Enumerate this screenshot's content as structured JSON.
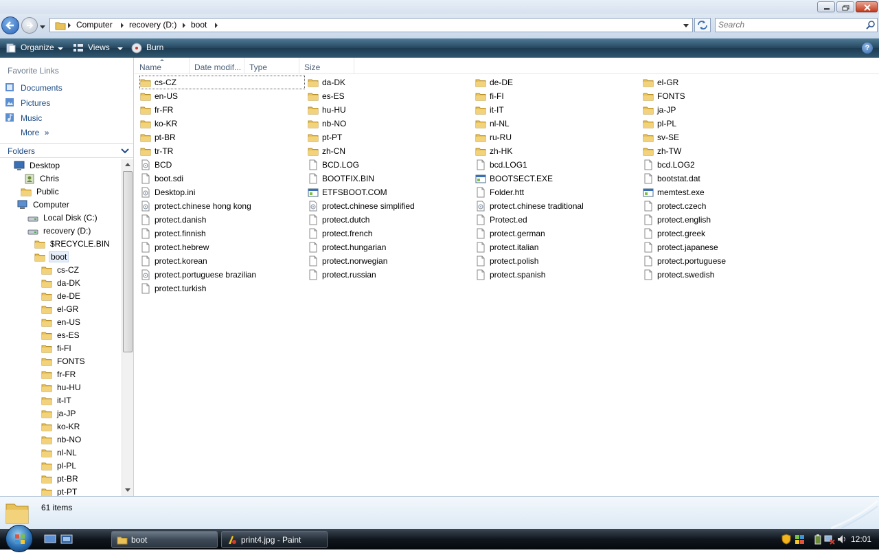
{
  "window": {
    "breadcrumb": [
      "Computer",
      "recovery (D:)",
      "boot"
    ],
    "search_placeholder": "Search"
  },
  "toolbar": {
    "organize": "Organize",
    "views": "Views",
    "burn": "Burn"
  },
  "nav": {
    "favorites_header": "Favorite Links",
    "favorites": [
      "Documents",
      "Pictures",
      "Music"
    ],
    "more": "More",
    "folders_header": "Folders",
    "tree": [
      {
        "label": "Desktop",
        "icon": "desktop-icon"
      },
      {
        "label": "Chris",
        "icon": "user-folder-icon"
      },
      {
        "label": "Public",
        "icon": "folder-icon"
      },
      {
        "label": "Computer",
        "icon": "computer-icon"
      },
      {
        "label": "Local Disk (C:)",
        "icon": "drive-icon"
      },
      {
        "label": "recovery (D:)",
        "icon": "drive-icon"
      },
      {
        "label": "$RECYCLE.BIN",
        "icon": "folder-icon"
      },
      {
        "label": "boot",
        "icon": "folder-icon",
        "selected": true
      },
      {
        "label": "cs-CZ",
        "icon": "folder-icon"
      },
      {
        "label": "da-DK",
        "icon": "folder-icon"
      },
      {
        "label": "de-DE",
        "icon": "folder-icon"
      },
      {
        "label": "el-GR",
        "icon": "folder-icon"
      },
      {
        "label": "en-US",
        "icon": "folder-icon"
      },
      {
        "label": "es-ES",
        "icon": "folder-icon"
      },
      {
        "label": "fi-FI",
        "icon": "folder-icon"
      },
      {
        "label": "FONTS",
        "icon": "folder-icon"
      },
      {
        "label": "fr-FR",
        "icon": "folder-icon"
      },
      {
        "label": "hu-HU",
        "icon": "folder-icon"
      },
      {
        "label": "it-IT",
        "icon": "folder-icon"
      },
      {
        "label": "ja-JP",
        "icon": "folder-icon"
      },
      {
        "label": "ko-KR",
        "icon": "folder-icon"
      },
      {
        "label": "nb-NO",
        "icon": "folder-icon"
      },
      {
        "label": "nl-NL",
        "icon": "folder-icon"
      },
      {
        "label": "pl-PL",
        "icon": "folder-icon"
      },
      {
        "label": "pt-BR",
        "icon": "folder-icon"
      },
      {
        "label": "pt-PT",
        "icon": "folder-icon"
      }
    ]
  },
  "columns": [
    "Name",
    "Date modif...",
    "Type",
    "Size"
  ],
  "items": [
    {
      "name": "cs-CZ",
      "icon": "folder-icon"
    },
    {
      "name": "da-DK",
      "icon": "folder-icon"
    },
    {
      "name": "de-DE",
      "icon": "folder-icon"
    },
    {
      "name": "el-GR",
      "icon": "folder-icon"
    },
    {
      "name": "en-US",
      "icon": "folder-icon"
    },
    {
      "name": "es-ES",
      "icon": "folder-icon"
    },
    {
      "name": "fi-FI",
      "icon": "folder-icon"
    },
    {
      "name": "FONTS",
      "icon": "folder-icon"
    },
    {
      "name": "fr-FR",
      "icon": "folder-icon"
    },
    {
      "name": "hu-HU",
      "icon": "folder-icon"
    },
    {
      "name": "it-IT",
      "icon": "folder-icon"
    },
    {
      "name": "ja-JP",
      "icon": "folder-icon"
    },
    {
      "name": "ko-KR",
      "icon": "folder-icon"
    },
    {
      "name": "nb-NO",
      "icon": "folder-icon"
    },
    {
      "name": "nl-NL",
      "icon": "folder-icon"
    },
    {
      "name": "pl-PL",
      "icon": "folder-icon"
    },
    {
      "name": "pt-BR",
      "icon": "folder-icon"
    },
    {
      "name": "pt-PT",
      "icon": "folder-icon"
    },
    {
      "name": "ru-RU",
      "icon": "folder-icon"
    },
    {
      "name": "sv-SE",
      "icon": "folder-icon"
    },
    {
      "name": "tr-TR",
      "icon": "folder-icon"
    },
    {
      "name": "zh-CN",
      "icon": "folder-icon"
    },
    {
      "name": "zh-HK",
      "icon": "folder-icon"
    },
    {
      "name": "zh-TW",
      "icon": "folder-icon"
    },
    {
      "name": "BCD",
      "icon": "system-file-icon"
    },
    {
      "name": "BCD.LOG",
      "icon": "file-icon"
    },
    {
      "name": "bcd.LOG1",
      "icon": "file-icon"
    },
    {
      "name": "bcd.LOG2",
      "icon": "file-icon"
    },
    {
      "name": "boot.sdi",
      "icon": "file-icon"
    },
    {
      "name": "BOOTFIX.BIN",
      "icon": "file-icon"
    },
    {
      "name": "BOOTSECT.EXE",
      "icon": "exe-icon"
    },
    {
      "name": "bootstat.dat",
      "icon": "file-icon"
    },
    {
      "name": "Desktop.ini",
      "icon": "system-file-icon"
    },
    {
      "name": "ETFSBOOT.COM",
      "icon": "exe-icon"
    },
    {
      "name": "Folder.htt",
      "icon": "file-icon"
    },
    {
      "name": "memtest.exe",
      "icon": "exe-icon"
    },
    {
      "name": "protect.chinese hong kong",
      "icon": "system-file-icon"
    },
    {
      "name": "protect.chinese simplified",
      "icon": "system-file-icon"
    },
    {
      "name": "protect.chinese traditional",
      "icon": "system-file-icon"
    },
    {
      "name": "protect.czech",
      "icon": "file-icon"
    },
    {
      "name": "protect.danish",
      "icon": "file-icon"
    },
    {
      "name": "protect.dutch",
      "icon": "file-icon"
    },
    {
      "name": "Protect.ed",
      "icon": "file-icon"
    },
    {
      "name": "protect.english",
      "icon": "file-icon"
    },
    {
      "name": "protect.finnish",
      "icon": "file-icon"
    },
    {
      "name": "protect.french",
      "icon": "file-icon"
    },
    {
      "name": "protect.german",
      "icon": "file-icon"
    },
    {
      "name": "protect.greek",
      "icon": "file-icon"
    },
    {
      "name": "protect.hebrew",
      "icon": "file-icon"
    },
    {
      "name": "protect.hungarian",
      "icon": "file-icon"
    },
    {
      "name": "protect.italian",
      "icon": "file-icon"
    },
    {
      "name": "protect.japanese",
      "icon": "file-icon"
    },
    {
      "name": "protect.korean",
      "icon": "file-icon"
    },
    {
      "name": "protect.norwegian",
      "icon": "file-icon"
    },
    {
      "name": "protect.polish",
      "icon": "file-icon"
    },
    {
      "name": "protect.portuguese",
      "icon": "file-icon"
    },
    {
      "name": "protect.portuguese brazilian",
      "icon": "system-file-icon"
    },
    {
      "name": "protect.russian",
      "icon": "file-icon"
    },
    {
      "name": "protect.spanish",
      "icon": "file-icon"
    },
    {
      "name": "protect.swedish",
      "icon": "file-icon"
    },
    {
      "name": "protect.turkish",
      "icon": "file-icon"
    }
  ],
  "details": {
    "count": "61 items"
  },
  "taskbar": {
    "tasks": [
      {
        "label": "boot",
        "icon": "folder-icon"
      },
      {
        "label": "print4.jpg - Paint",
        "icon": "paint-icon"
      }
    ],
    "clock": "12:01"
  },
  "colors": {
    "command_bar": "#25475e",
    "link_blue": "#1f4c85",
    "folder_yellow": "#e8c15a"
  }
}
